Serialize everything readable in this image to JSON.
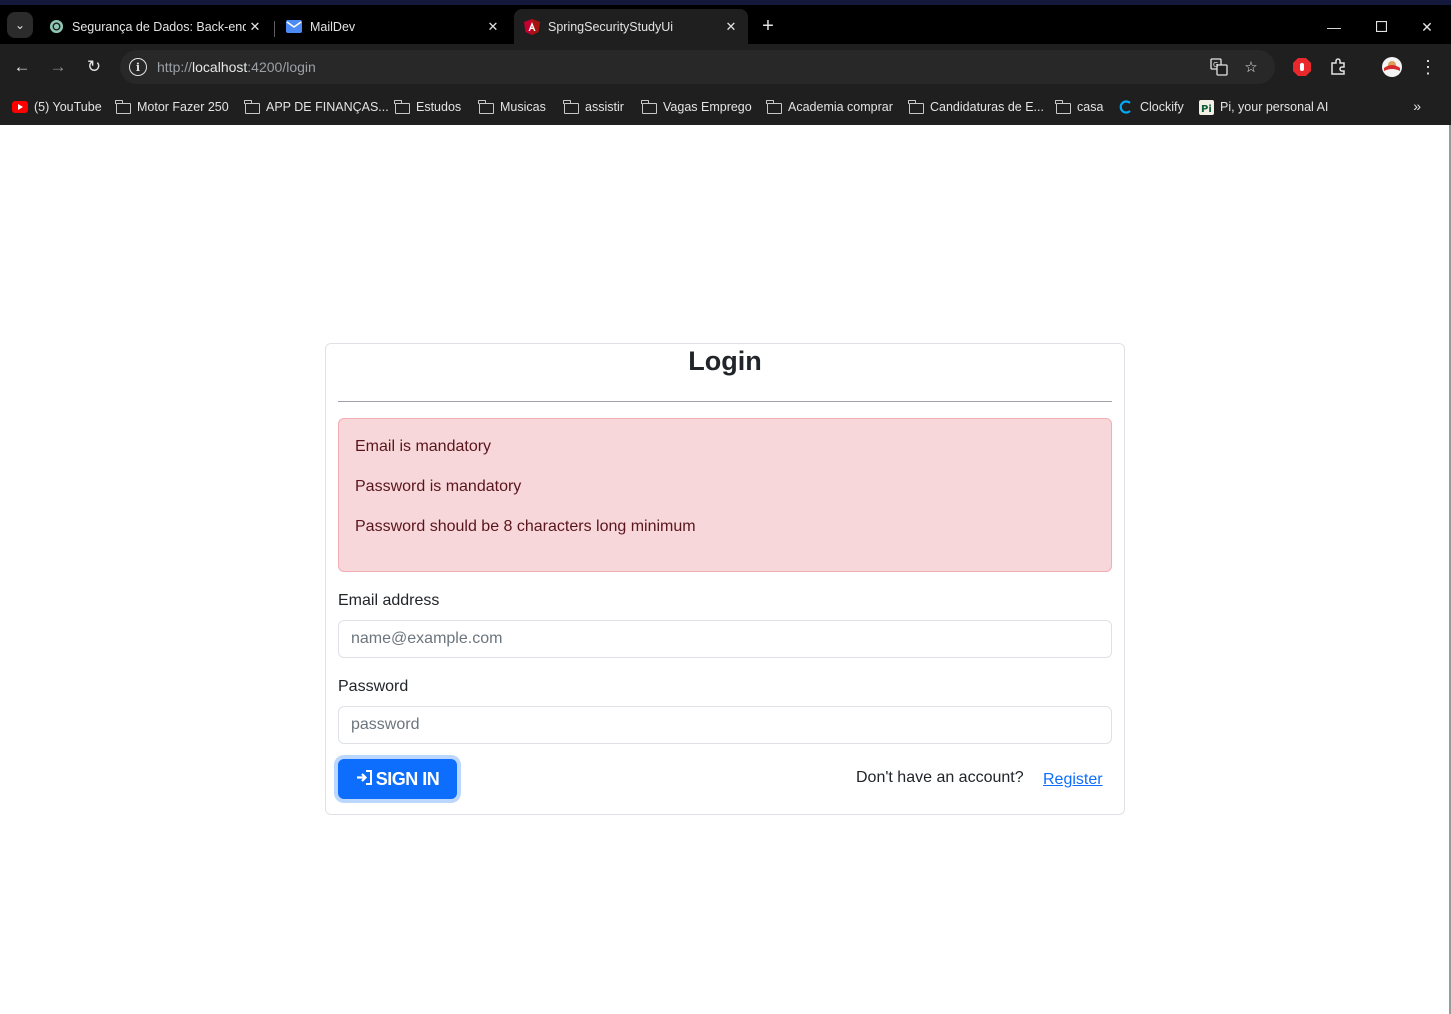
{
  "browser": {
    "tabs": [
      {
        "title": "Segurança de Dados: Back-end",
        "icon": "chatgpt-icon",
        "active": false
      },
      {
        "title": "MailDev",
        "icon": "mail-icon",
        "active": false
      },
      {
        "title": "SpringSecurityStudyUi",
        "icon": "angular-icon",
        "active": true
      }
    ],
    "url": {
      "scheme": "http://",
      "host": "localhost",
      "rest": ":4200/login"
    },
    "bookmarks": [
      {
        "label": "(5) YouTube",
        "icon": "youtube-icon"
      },
      {
        "label": "Motor Fazer 250",
        "icon": "folder-icon"
      },
      {
        "label": "APP DE FINANÇAS...",
        "icon": "folder-icon"
      },
      {
        "label": "Estudos",
        "icon": "folder-icon"
      },
      {
        "label": "Musicas",
        "icon": "folder-icon"
      },
      {
        "label": "assistir",
        "icon": "folder-icon"
      },
      {
        "label": "Vagas Emprego",
        "icon": "folder-icon"
      },
      {
        "label": "Academia comprar",
        "icon": "folder-icon"
      },
      {
        "label": "Candidaturas de E...",
        "icon": "folder-icon"
      },
      {
        "label": "casa",
        "icon": "folder-icon"
      },
      {
        "label": "Clockify",
        "icon": "clockify-icon"
      },
      {
        "label": "Pi, your personal AI",
        "icon": "pi-icon"
      }
    ]
  },
  "login": {
    "title": "Login",
    "errors": [
      "Email is mandatory",
      "Password is mandatory",
      "Password should be 8 characters long minimum"
    ],
    "email": {
      "label": "Email address",
      "placeholder": "name@example.com",
      "value": ""
    },
    "password": {
      "label": "Password",
      "placeholder": "password",
      "value": ""
    },
    "signin_label": "SIGN IN",
    "no_account_text": "Don't have an account?",
    "register_label": "Register"
  },
  "colors": {
    "primary": "#0d6efd",
    "alert_bg": "#f8d7da",
    "alert_text": "#58151c"
  }
}
